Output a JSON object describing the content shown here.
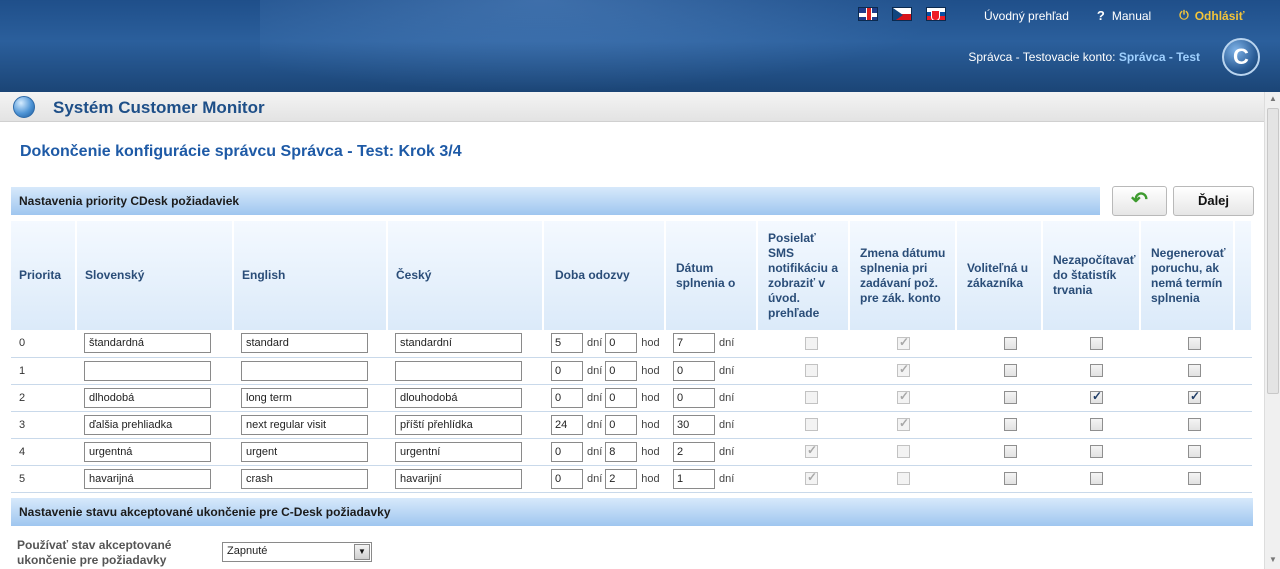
{
  "header": {
    "flags": [
      {
        "name": "uk-flag-icon",
        "lang": "English"
      },
      {
        "name": "cz-flag-icon",
        "lang": "Czech"
      },
      {
        "name": "sk-flag-icon",
        "lang": "Slovak"
      }
    ],
    "overview_link": "Úvodný prehľad",
    "manual_icon": "?",
    "manual_link": "Manual",
    "logout_icon": "⏻",
    "logout_link": "Odhlásiť",
    "account_prefix": "Správca - Testovacie konto: ",
    "account_name": "Správca - Test",
    "logo_letter": "C"
  },
  "app": {
    "title": "Systém Customer Monitor"
  },
  "page": {
    "title": "Dokončenie konfigurácie správcu Správca - Test: Krok 3/4"
  },
  "section_priority": {
    "title": "Nastavenia priority CDesk požiadaviek",
    "back_icon": "↶",
    "next_label": "Ďalej"
  },
  "columns": {
    "priority": "Priorita",
    "sk": "Slovenský",
    "en": "English",
    "cz": "Český",
    "response": "Doba odozvy",
    "due": "Dátum splnenia o",
    "sms": "Posielať SMS notifikáciu a zobraziť v úvod. prehľade",
    "change_date": "Zmena dátumu splnenia pri zadávaní pož. pre zák. konto",
    "optional": "Voliteľná u zákazníka",
    "no_stats": "Nezapočítavať do štatistík trvania",
    "no_fault": "Negenerovať poruchu, ak nemá termín splnenia"
  },
  "units": {
    "days": "dní",
    "hours": "hod"
  },
  "rows": [
    {
      "priority": "0",
      "sk": "štandardná",
      "en": "standard",
      "cz": "standardní",
      "resp_days": "5",
      "resp_hours": "0",
      "due_days": "7"
    },
    {
      "priority": "1",
      "sk": "",
      "en": "",
      "cz": "",
      "resp_days": "0",
      "resp_hours": "0",
      "due_days": "0"
    },
    {
      "priority": "2",
      "sk": "dlhodobá",
      "en": "long term",
      "cz": "dlouhodobá",
      "resp_days": "0",
      "resp_hours": "0",
      "due_days": "0"
    },
    {
      "priority": "3",
      "sk": "ďalšia prehliadka",
      "en": "next regular visit",
      "cz": "příští přehlídka",
      "resp_days": "24",
      "resp_hours": "0",
      "due_days": "30"
    },
    {
      "priority": "4",
      "sk": "urgentná",
      "en": "urgent",
      "cz": "urgentní",
      "resp_days": "0",
      "resp_hours": "8",
      "due_days": "2"
    },
    {
      "priority": "5",
      "sk": "havarijná",
      "en": "crash",
      "cz": "havarijní",
      "resp_days": "0",
      "resp_hours": "2",
      "due_days": "1"
    }
  ],
  "section_accept": {
    "title": "Nastavenie stavu akceptované ukončenie pre C-Desk požiadavky",
    "label": "Používať stav akceptované ukončenie pre požiadavky",
    "select_value": "Zapnuté"
  }
}
